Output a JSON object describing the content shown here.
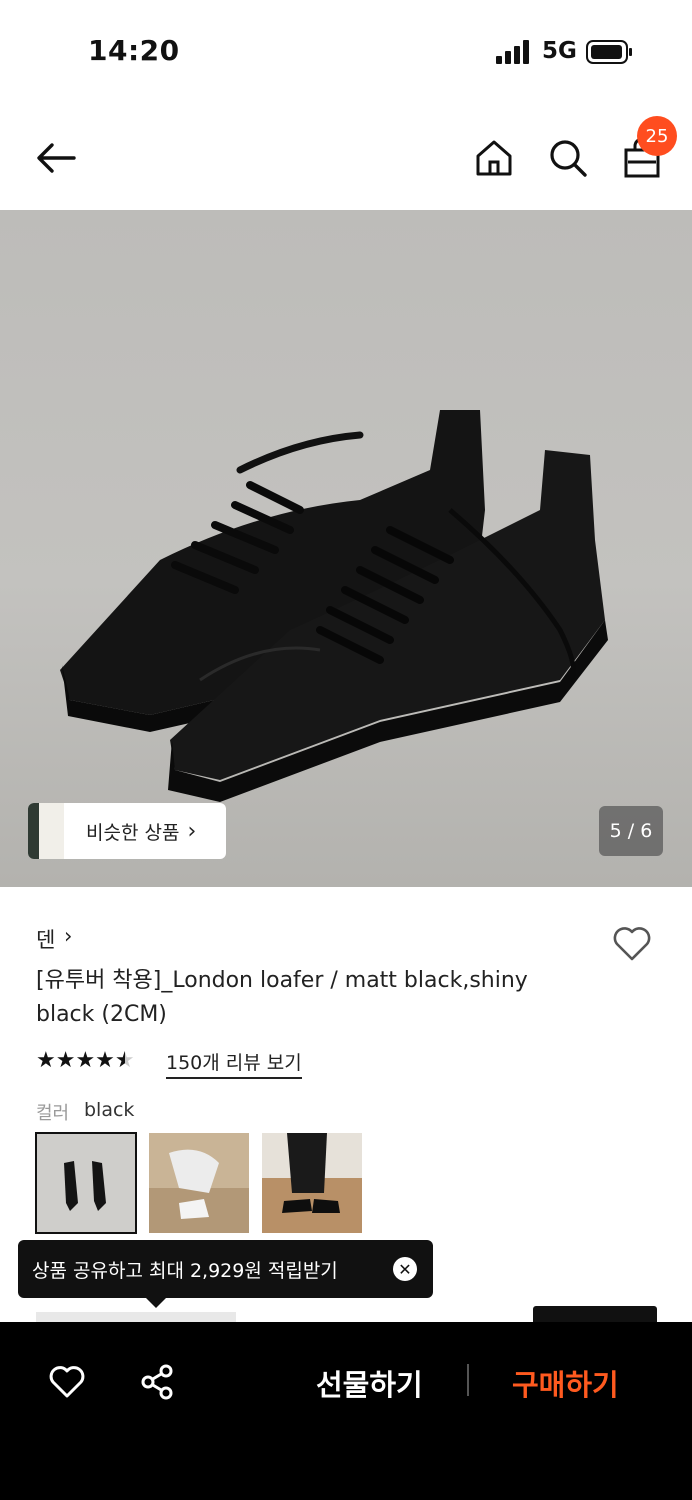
{
  "status_bar": {
    "time": "14:20",
    "network": "5G"
  },
  "header": {
    "cart_count": "25",
    "icons": [
      "back-arrow-icon",
      "home-icon",
      "search-icon",
      "shopping-bag-icon"
    ]
  },
  "gallery": {
    "similar_label": "비슷한 상품",
    "similar_chevron": "›",
    "counter": "5 / 6"
  },
  "product": {
    "brand": "덴",
    "brand_chevron": "›",
    "title": "[유투버 착용]_London loafer / matt black,shiny black (2CM)",
    "rating": 4.5,
    "stars_glyph": "★★★★★",
    "review_link": "150개 리뷰 보기",
    "color_label": "컬러",
    "color_value": "black"
  },
  "tooltip": {
    "text": "상품 공유하고 최대 2,929원 적립받기",
    "close": "✕"
  },
  "bottom_bar": {
    "gift_label": "선물하기",
    "buy_label": "구매하기",
    "accent": "#ff5a1f"
  }
}
